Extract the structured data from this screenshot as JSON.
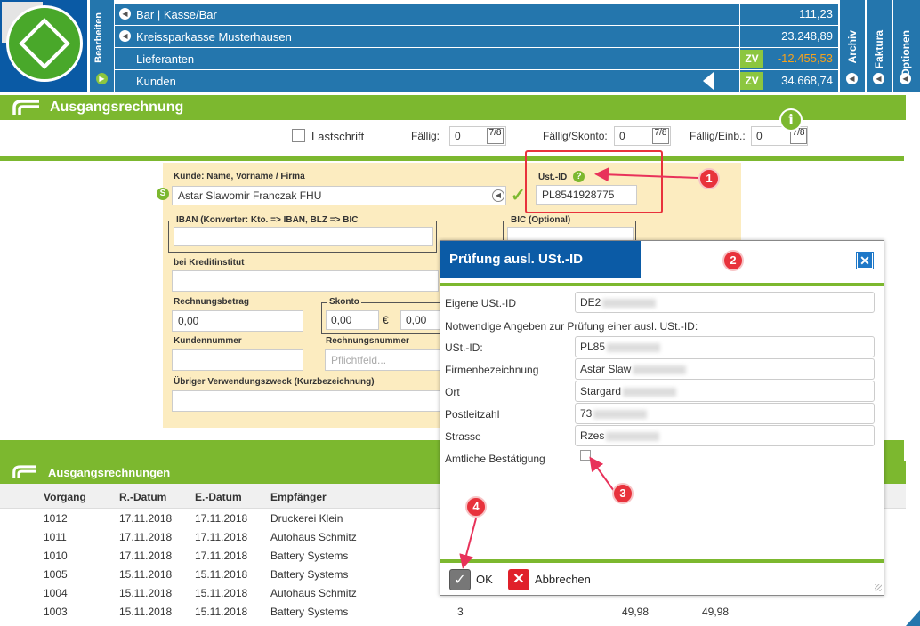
{
  "top": {
    "edit_label": "Bearbeiten",
    "accounts": [
      {
        "label": "Bar | Kasse/Bar",
        "value": "111,23",
        "zv": "",
        "value_color": "#ffffff",
        "arrow": true
      },
      {
        "label": "Kreissparkasse Musterhausen",
        "value": "23.248,89",
        "zv": "",
        "value_color": "#ffffff",
        "arrow": true
      },
      {
        "label": "Lieferanten",
        "value": "-12.455,53",
        "zv": "ZV",
        "value_color": "#f7a21b",
        "arrow": false
      },
      {
        "label": "Kunden",
        "value": "34.668,74",
        "zv": "ZV",
        "value_color": "#ffffff",
        "arrow": false
      }
    ],
    "side_buttons": [
      "Archiv",
      "Faktura",
      "Optionen"
    ]
  },
  "section": {
    "title": "Ausgangsrechnung",
    "lastschrift_label": "Lastschrift",
    "faellig_label": "Fällig:",
    "faellig_value": "0",
    "skonto_faellig_label": "Fällig/Skonto:",
    "skonto_faellig_value": "0",
    "einb_label": "Fällig/Einb.:",
    "einb_value": "0",
    "cal_label": "7/8"
  },
  "form": {
    "kunde_label": "Kunde: Name, Vorname / Firma",
    "kunde_value": "Astar Slawomir Franczak FHU",
    "ustid_label": "Ust.-ID",
    "ustid_value": "PL8541928775",
    "iban_label": "IBAN (Konverter: Kto. => IBAN, BLZ => BIC",
    "bic_label": "BIC (Optional)",
    "kreditinstitut_label": "bei Kreditinstitut",
    "betrag_label": "Rechnungsbetrag",
    "betrag_value": "0,00",
    "skonto_label": "Skonto",
    "skonto_value1": "0,00",
    "skonto_currency": "€",
    "skonto_value2": "0,00",
    "kundennummer_label": "Kundennummer",
    "rechnungsnummer_label": "Rechnungsnummer",
    "rechnungsnummer_placeholder": "Pflichtfeld...",
    "zweck_label": "Übriger Verwendungszweck (Kurzbezeichnung)"
  },
  "list": {
    "title": "Ausgangsrechnungen",
    "columns": [
      "Vorgang",
      "R.-Datum",
      "E.-Datum",
      "Empfänger"
    ],
    "rows": [
      {
        "vorgang": "1012",
        "rdatum": "17.11.2018",
        "edatum": "17.11.2018",
        "empf": "Druckerei Klein",
        "c5": "",
        "c6": "",
        "c7": ""
      },
      {
        "vorgang": "1011",
        "rdatum": "17.11.2018",
        "edatum": "17.11.2018",
        "empf": "Autohaus Schmitz",
        "c5": "",
        "c6": "",
        "c7": ""
      },
      {
        "vorgang": "1010",
        "rdatum": "17.11.2018",
        "edatum": "17.11.2018",
        "empf": "Battery Systems",
        "c5": "",
        "c6": "",
        "c7": ""
      },
      {
        "vorgang": "1005",
        "rdatum": "15.11.2018",
        "edatum": "15.11.2018",
        "empf": "Battery Systems",
        "c5": "",
        "c6": "",
        "c7": ""
      },
      {
        "vorgang": "1004",
        "rdatum": "15.11.2018",
        "edatum": "15.11.2018",
        "empf": "Autohaus Schmitz",
        "c5": "",
        "c6": "",
        "c7": ""
      },
      {
        "vorgang": "1003",
        "rdatum": "15.11.2018",
        "edatum": "15.11.2018",
        "empf": "Battery Systems",
        "c5": "3",
        "c6": "49,98",
        "c7": "49,98"
      }
    ]
  },
  "dialog": {
    "title": "Prüfung ausl. USt.-ID",
    "eigene_label": "Eigene USt.-ID",
    "eigene_value": "DE2",
    "hint": "Notwendige Angeben zur Prüfung einer ausl. USt.-ID:",
    "fields": [
      {
        "label": "USt.-ID:",
        "value": "PL85"
      },
      {
        "label": "Firmenbezeichnung",
        "value": "Astar Slaw"
      },
      {
        "label": "Ort",
        "value": "Stargard"
      },
      {
        "label": "Postleitzahl",
        "value": "73"
      },
      {
        "label": "Strasse",
        "value": "Rzes"
      }
    ],
    "bestaetigung_label": "Amtliche Bestätigung",
    "ok_label": "OK",
    "cancel_label": "Abbrechen"
  },
  "annotations": [
    "1",
    "2",
    "3",
    "4"
  ],
  "colors": {
    "brand_blue": "#2476ad",
    "brand_green": "#7cb82f",
    "highlight_red": "#e8323c",
    "negative_orange": "#f7a21b"
  }
}
